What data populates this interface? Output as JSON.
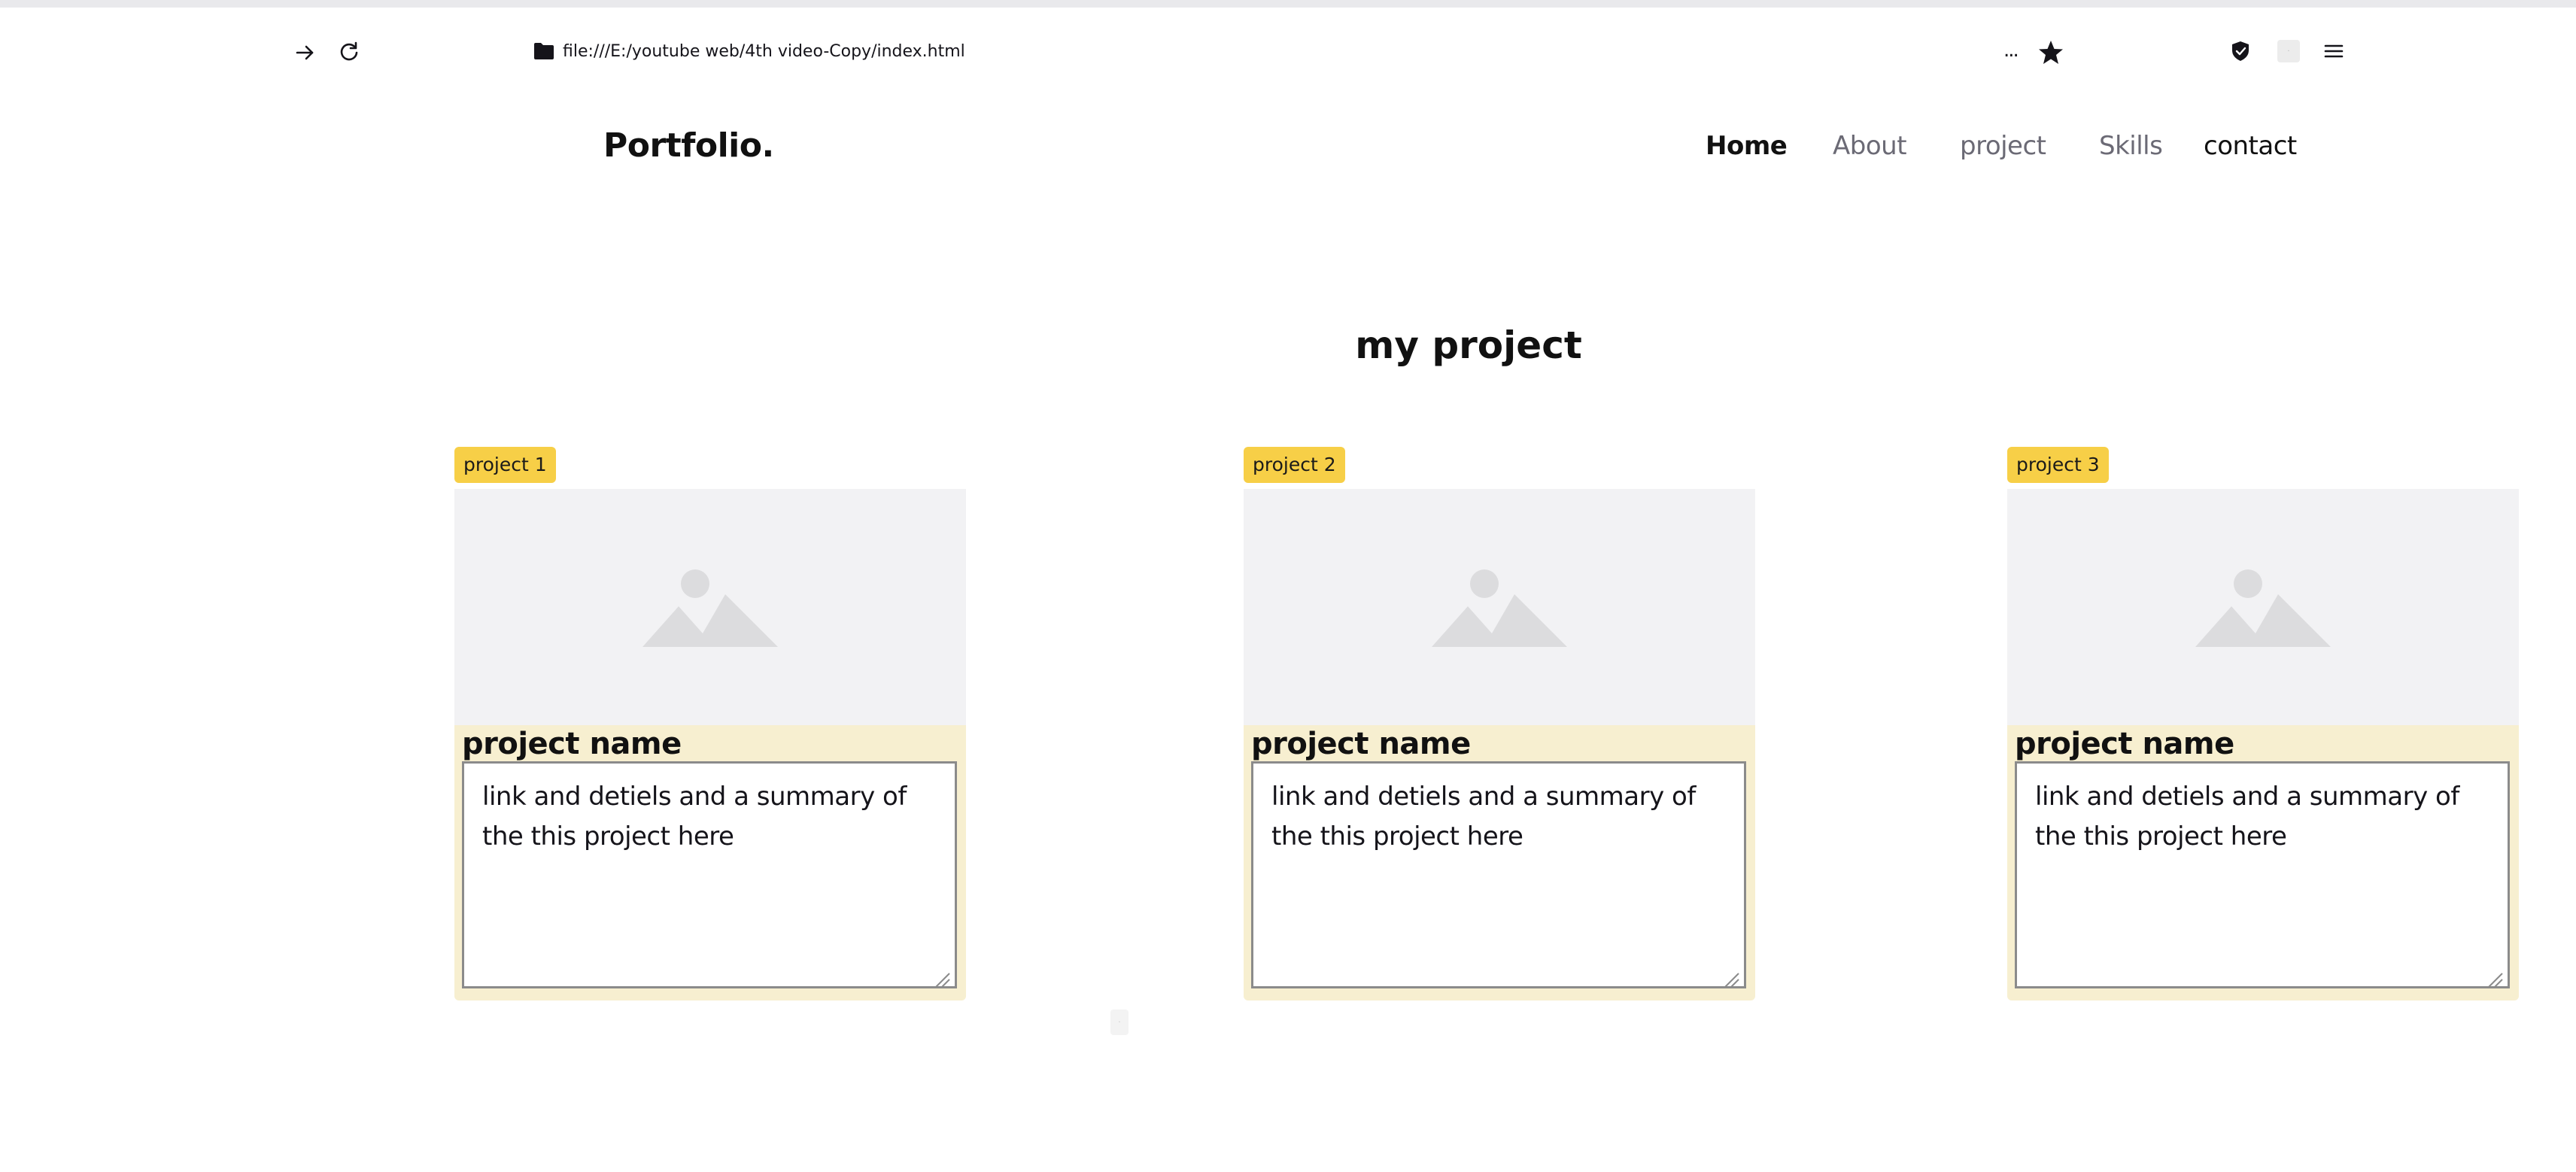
{
  "browser": {
    "url": "file:///E:/youtube web/4th video-Copy/index.html",
    "ellipsis": "...",
    "icons": [
      "forward-arrow-icon",
      "reload-icon",
      "folder-icon",
      "bookmark-star-icon",
      "shield-icon",
      "menu-icon"
    ]
  },
  "site": {
    "logo": "Portfolio.",
    "nav": {
      "home": "Home",
      "about": "About",
      "project": "project",
      "skills": "Skills",
      "contact": "contact"
    },
    "section_title": "my project"
  },
  "projects": [
    {
      "tag": "project 1",
      "name": "project name",
      "summary": "link and detiels and a summary of the this project here"
    },
    {
      "tag": "project 2",
      "name": "project name",
      "summary": "link and detiels and a summary of the this project here"
    },
    {
      "tag": "project 3",
      "name": "project name",
      "summary": "link and detiels and a summary of the this project here"
    }
  ],
  "colors": {
    "tag_bg": "#f7cf47",
    "card_body_bg": "#f7efd0",
    "image_placeholder_bg": "#f2f2f4",
    "nav_active": "#111111",
    "nav_muted": "#6b6a75"
  }
}
